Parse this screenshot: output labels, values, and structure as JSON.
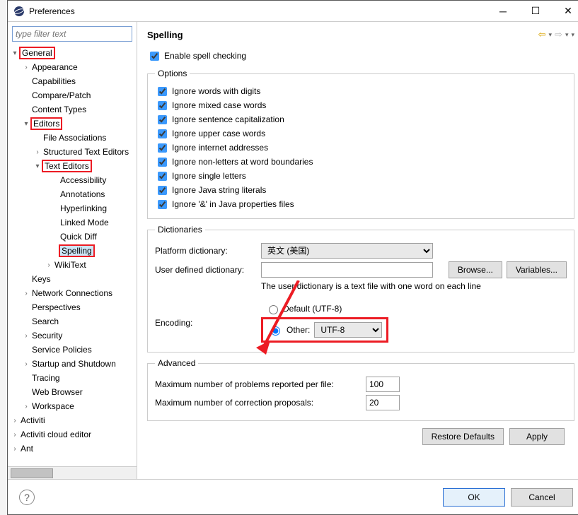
{
  "window": {
    "title": "Preferences"
  },
  "filter": {
    "placeholder": "type filter text"
  },
  "tree": {
    "general": "General",
    "appearance": "Appearance",
    "capabilities": "Capabilities",
    "compare": "Compare/Patch",
    "contentTypes": "Content Types",
    "editors": "Editors",
    "fileAssoc": "File Associations",
    "structured": "Structured Text Editors",
    "textEditors": "Text Editors",
    "accessibility": "Accessibility",
    "annotations": "Annotations",
    "hyperlinking": "Hyperlinking",
    "linkedMode": "Linked Mode",
    "quickDiff": "Quick Diff",
    "spelling": "Spelling",
    "wikiText": "WikiText",
    "keys": "Keys",
    "network": "Network Connections",
    "perspectives": "Perspectives",
    "search": "Search",
    "security": "Security",
    "servicePolicies": "Service Policies",
    "startup": "Startup and Shutdown",
    "tracing": "Tracing",
    "webBrowser": "Web Browser",
    "workspace": "Workspace",
    "activiti": "Activiti",
    "activitiCloud": "Activiti cloud editor",
    "ant": "Ant"
  },
  "page": {
    "title": "Spelling",
    "enable": "Enable spell checking",
    "options": {
      "legend": "Options",
      "o1": "Ignore words with digits",
      "o2": "Ignore mixed case words",
      "o3": "Ignore sentence capitalization",
      "o4": "Ignore upper case words",
      "o5": "Ignore internet addresses",
      "o6": "Ignore non-letters at word boundaries",
      "o7": "Ignore single letters",
      "o8": "Ignore Java string literals",
      "o9": "Ignore '&' in Java properties files"
    },
    "dict": {
      "legend": "Dictionaries",
      "platform": "Platform dictionary:",
      "platformValue": "英文 (美国)",
      "user": "User defined dictionary:",
      "browse": "Browse...",
      "variables": "Variables...",
      "hint": "The user dictionary is a text file with one word on each line",
      "encoding": "Encoding:",
      "default": "Default (UTF-8)",
      "other": "Other:",
      "otherValue": "UTF-8"
    },
    "adv": {
      "legend": "Advanced",
      "maxProblems": "Maximum number of problems reported per file:",
      "maxProblemsValue": "100",
      "maxProposals": "Maximum number of correction proposals:",
      "maxProposalsValue": "20"
    },
    "restore": "Restore Defaults",
    "apply": "Apply"
  },
  "footer": {
    "ok": "OK",
    "cancel": "Cancel"
  }
}
